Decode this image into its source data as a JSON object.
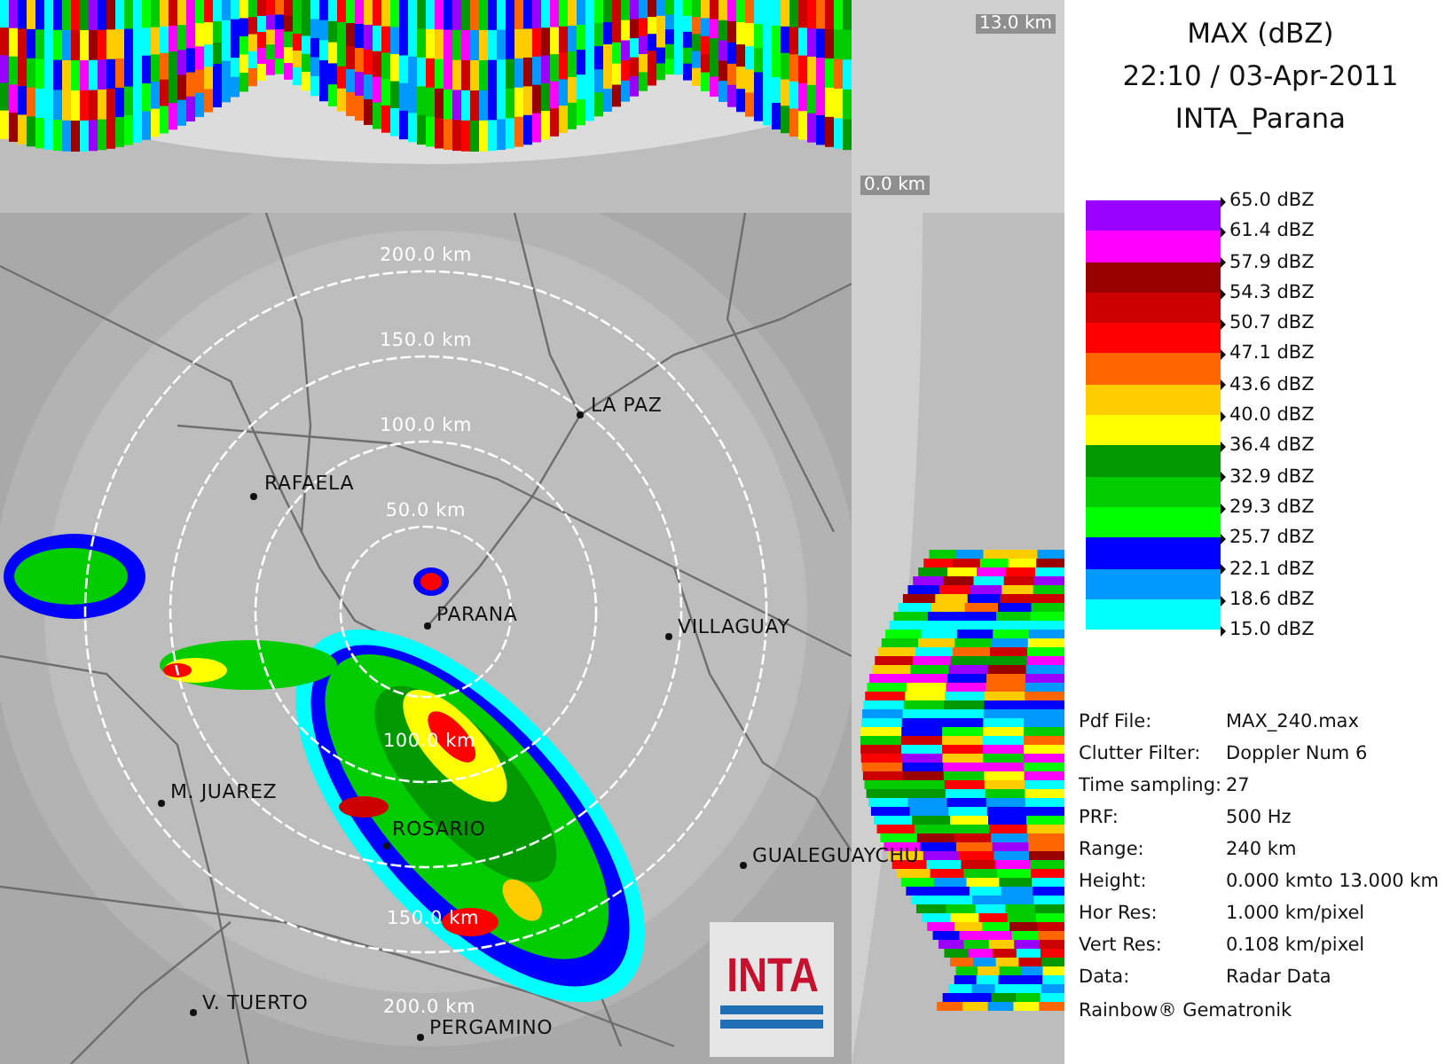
{
  "cross_section": {
    "height_labels": [
      "13.0 km",
      "0.0 km"
    ]
  },
  "map": {
    "range_labels": [
      "200.0 km",
      "150.0 km",
      "100.0 km",
      "50.0 km",
      "100.0 km",
      "150.0 km",
      "200.0 km"
    ],
    "cities": [
      "LA PAZ",
      "RAFAELA",
      "PARANA",
      "VILLAGUAY",
      "M. JUAREZ",
      "ROSARIO",
      "GUALEGUAYCHU",
      "V. TUERTO",
      "PERGAMINO"
    ],
    "logo": "INTA"
  },
  "title": {
    "product": "MAX (dBZ)",
    "datetime": "22:10 / 03-Apr-2011",
    "station": "INTA_Parana"
  },
  "legend": {
    "labels": [
      "65.0 dBZ",
      "61.4 dBZ",
      "57.9 dBZ",
      "54.3 dBZ",
      "50.7 dBZ",
      "47.1 dBZ",
      "43.6 dBZ",
      "40.0 dBZ",
      "36.4 dBZ",
      "32.9 dBZ",
      "29.3 dBZ",
      "25.7 dBZ",
      "22.1 dBZ",
      "18.6 dBZ",
      "15.0 dBZ"
    ],
    "bands": [
      {
        "color": "#9900ff"
      },
      {
        "color": "#ff00ff"
      },
      {
        "color": "#990000"
      },
      {
        "color": "#cc0000"
      },
      {
        "color": "#ff0000"
      },
      {
        "color": "#ff6600"
      },
      {
        "color": "#ffcc00"
      },
      {
        "color": "#ffff00"
      },
      {
        "color": "#009900"
      },
      {
        "color": "#00cc00"
      },
      {
        "color": "#00ff00"
      },
      {
        "color": "#0000ff"
      },
      {
        "color": "#0099ff"
      },
      {
        "color": "#00ffff"
      }
    ]
  },
  "info": [
    {
      "label": "Pdf File:",
      "value": "MAX_240.max"
    },
    {
      "label": "Clutter Filter:",
      "value": "Doppler Num 6"
    },
    {
      "label": "Time sampling:",
      "value": "27"
    },
    {
      "label": "PRF:",
      "value": "500 Hz"
    },
    {
      "label": "Range:",
      "value": "240 km"
    },
    {
      "label": "Height:",
      "value": "0.000 kmto 13.000 km"
    },
    {
      "label": "Hor Res:",
      "value": "1.000 km/pixel"
    },
    {
      "label": "Vert Res:",
      "value": "0.108 km/pixel"
    },
    {
      "label": "Data:",
      "value": "Radar Data"
    }
  ],
  "credit": "Rainbow® Gematronik"
}
